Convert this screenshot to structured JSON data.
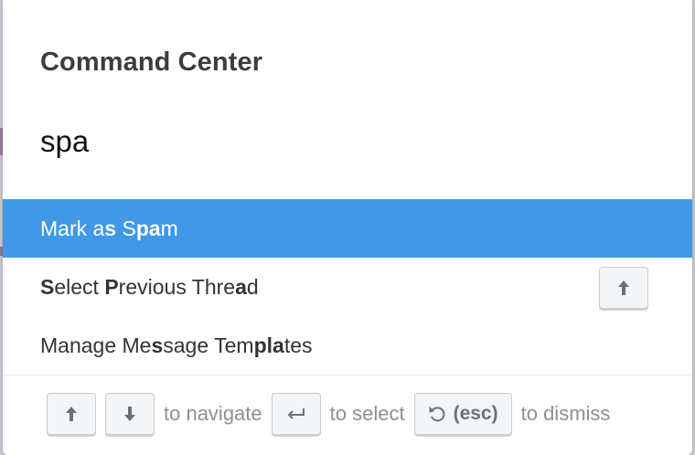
{
  "dialog": {
    "title": "Command Center",
    "query": "spa"
  },
  "results": [
    {
      "label_parts": [
        {
          "text": "Mark a",
          "bold": false
        },
        {
          "text": "s",
          "bold": true
        },
        {
          "text": " S",
          "bold": false
        },
        {
          "text": "pa",
          "bold": true
        },
        {
          "text": "m",
          "bold": false
        }
      ],
      "selected": true
    },
    {
      "label_parts": [
        {
          "text": "S",
          "bold": true
        },
        {
          "text": "elect ",
          "bold": false
        },
        {
          "text": "P",
          "bold": true
        },
        {
          "text": "revious Thre",
          "bold": false
        },
        {
          "text": "a",
          "bold": true
        },
        {
          "text": "d",
          "bold": false
        }
      ],
      "selected": false,
      "shortcut_icon": "arrow-up-icon"
    },
    {
      "label_parts": [
        {
          "text": "Manage Me",
          "bold": false
        },
        {
          "text": "s",
          "bold": true
        },
        {
          "text": "sage Tem",
          "bold": false
        },
        {
          "text": "pla",
          "bold": true
        },
        {
          "text": "tes",
          "bold": false
        }
      ],
      "selected": false
    }
  ],
  "footer": {
    "navigate_text": "to navigate",
    "select_text": "to select",
    "esc_label": "(esc)",
    "dismiss_text": "to dismiss",
    "icons": [
      "arrow-up-icon",
      "arrow-down-icon",
      "return-icon",
      "undo-icon"
    ]
  },
  "colors": {
    "selected_row": "#4098e6",
    "title": "#3d3d3d",
    "hint_text": "#8a9096"
  }
}
